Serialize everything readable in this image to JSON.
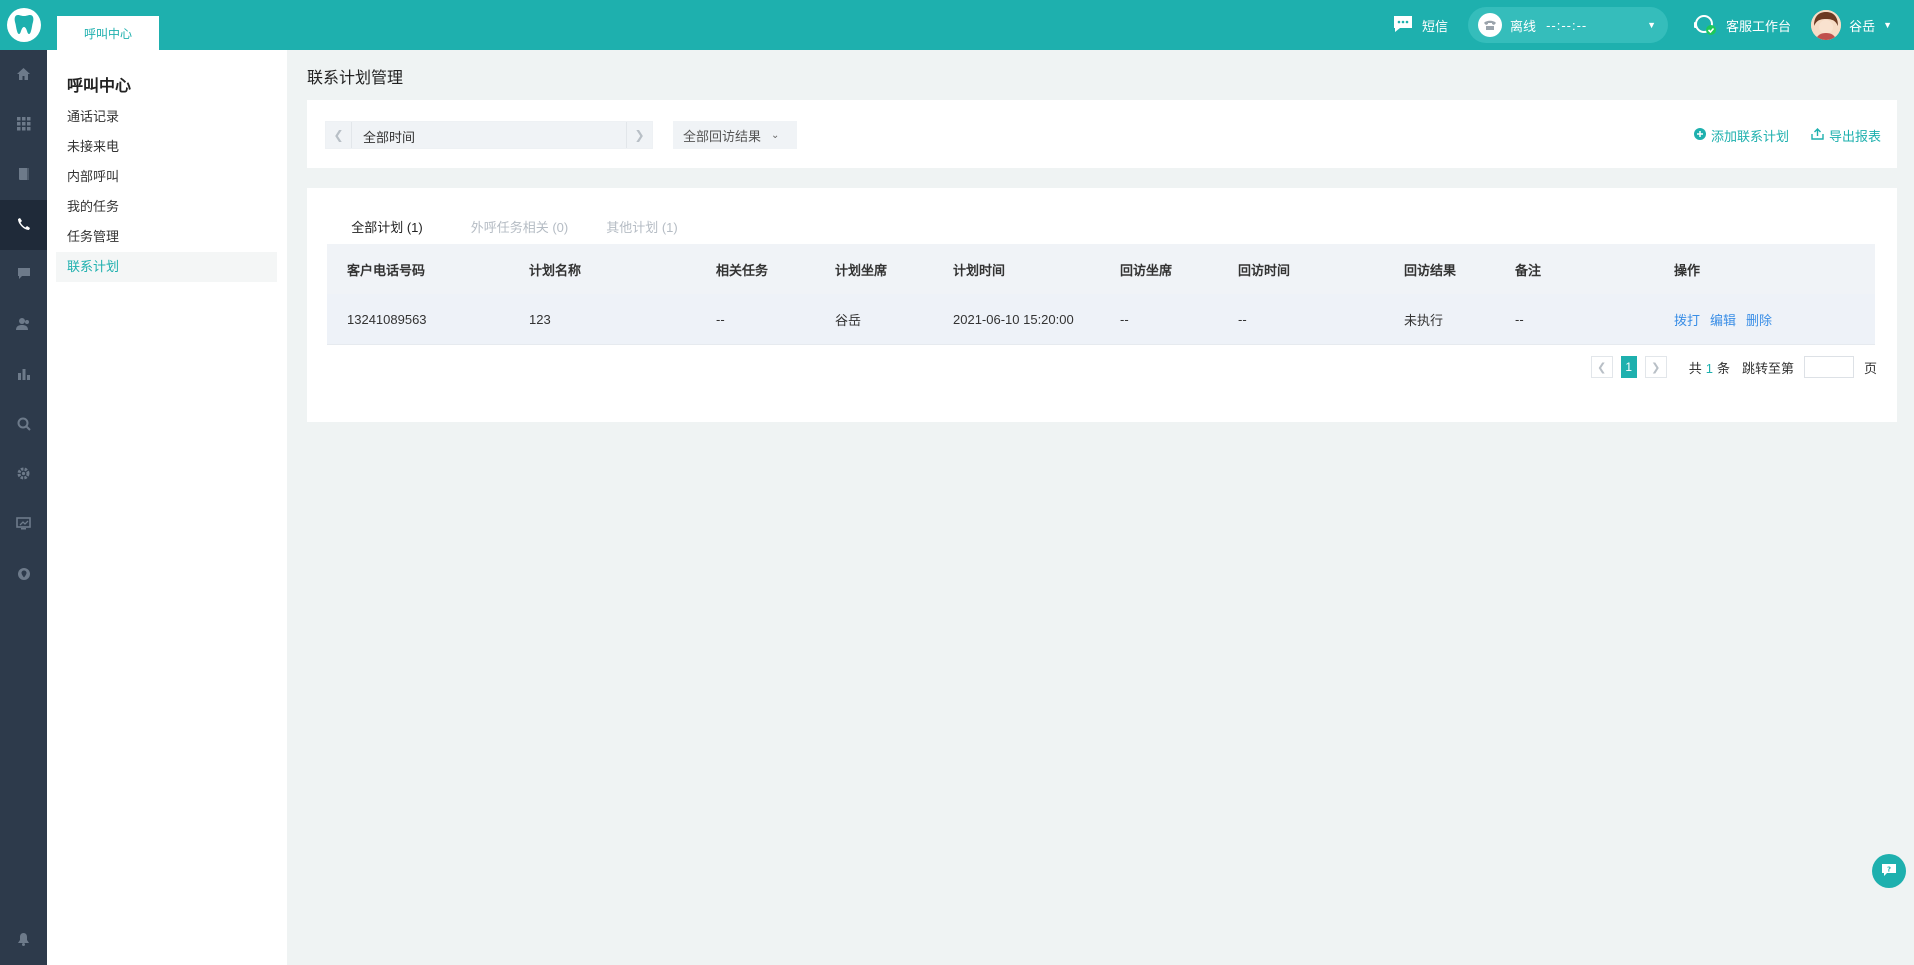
{
  "topbar": {
    "tab_label": "呼叫中心",
    "sms_label": "短信",
    "line_status": "离线",
    "line_timer": "--:--:--",
    "workbench_label": "客服工作台",
    "user_name": "谷岳"
  },
  "submenu": {
    "title": "呼叫中心",
    "items": [
      "通话记录",
      "未接来电",
      "内部呼叫",
      "我的任务",
      "任务管理",
      "联系计划"
    ]
  },
  "page": {
    "title": "联系计划管理"
  },
  "filters": {
    "date_range": "全部时间",
    "result_select": "全部回访结果",
    "add_plan": "添加联系计划",
    "export_report": "导出报表"
  },
  "tabs": [
    "全部计划 (1)",
    "外呼任务相关 (0)",
    "其他计划 (1)"
  ],
  "table": {
    "headers": [
      "客户电话号码",
      "计划名称",
      "相关任务",
      "计划坐席",
      "计划时间",
      "回访坐席",
      "回访时间",
      "回访结果",
      "备注",
      "操作"
    ],
    "rows": [
      [
        "13241089563",
        "123",
        "--",
        "谷岳",
        "2021-06-10 15:20:00",
        "--",
        "--",
        "未执行",
        "--"
      ]
    ],
    "ops": [
      "拨打",
      "编辑",
      "删除"
    ]
  },
  "pagination": {
    "current": "1",
    "total_prefix": "共",
    "total_count": "1",
    "total_suffix": "条",
    "jump_label": "跳转至第",
    "page_unit": "页"
  },
  "colors": {
    "brand": "#1eb0ae",
    "rail": "#2d3a4b",
    "link": "#3a8ee6"
  }
}
